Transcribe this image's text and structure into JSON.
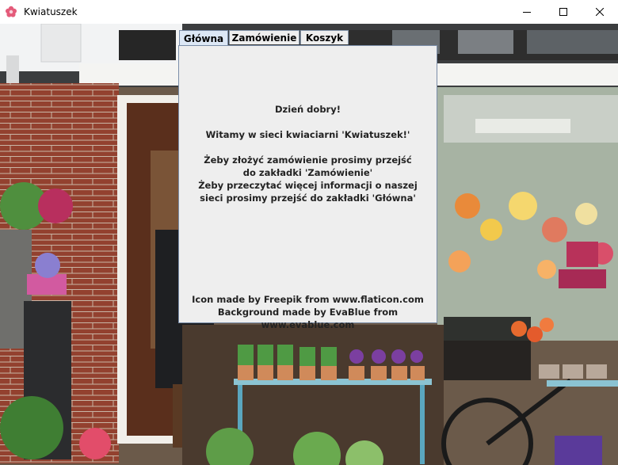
{
  "window": {
    "title": "Kwiatuszek",
    "icon": "flower-icon",
    "controls": [
      "minimize-icon",
      "maximize-icon",
      "close-icon"
    ]
  },
  "tabs": [
    {
      "label": "Główna",
      "active": true
    },
    {
      "label": "Zamówienie",
      "active": false
    },
    {
      "label": "Koszyk",
      "active": false
    }
  ],
  "main": {
    "greeting": "Dzień dobry!",
    "welcome": "Witamy w sieci kwiaciarni 'Kwiatuszek!'",
    "order_line1": "Żeby złożyć zamówienie prosimy przejść",
    "order_line2": "do zakładki 'Zamówienie'",
    "info_line1": "Żeby przeczytać więcej informacji o naszej",
    "info_line2": "sieci prosimy przejść do zakładki 'Główna'"
  },
  "credits": {
    "icon_credit": "Icon made by Freepik from www.flaticon.com",
    "background_credit": "Background made by EvaBlue from www.evablue.com"
  },
  "colors": {
    "accent": "#dce7f5",
    "panel": "#eeeeee",
    "border": "#7a8da8"
  }
}
